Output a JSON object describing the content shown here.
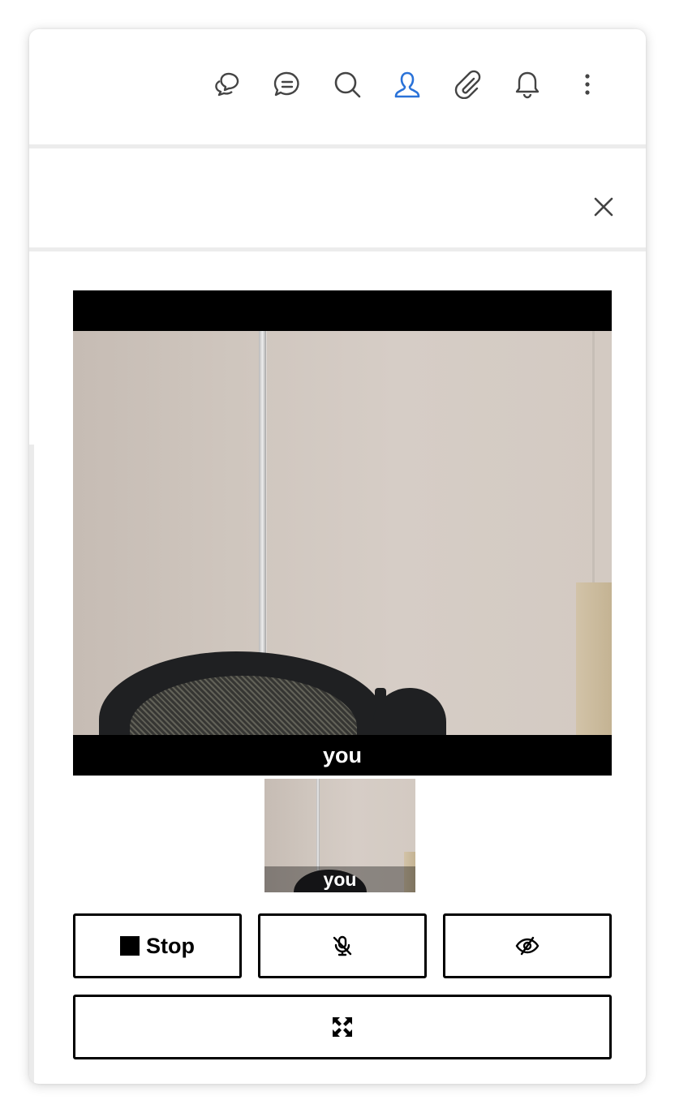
{
  "toolbar": {
    "icons": [
      "chats-icon",
      "chat-icon",
      "search-icon",
      "user-icon",
      "paperclip-icon",
      "bell-icon",
      "more-vertical-icon"
    ],
    "active_icon": "user-icon",
    "active_color": "#2a72d8",
    "icon_color": "#444444"
  },
  "panel": {
    "close_icon": "close-icon"
  },
  "video": {
    "main_label": "you",
    "thumbnail_label": "you"
  },
  "controls": {
    "stop_label": "Stop",
    "stop_icon": "stop-square-icon",
    "mute_icon": "mic-off-icon",
    "hide_icon": "eye-off-icon",
    "fullscreen_icon": "expand-icon"
  }
}
